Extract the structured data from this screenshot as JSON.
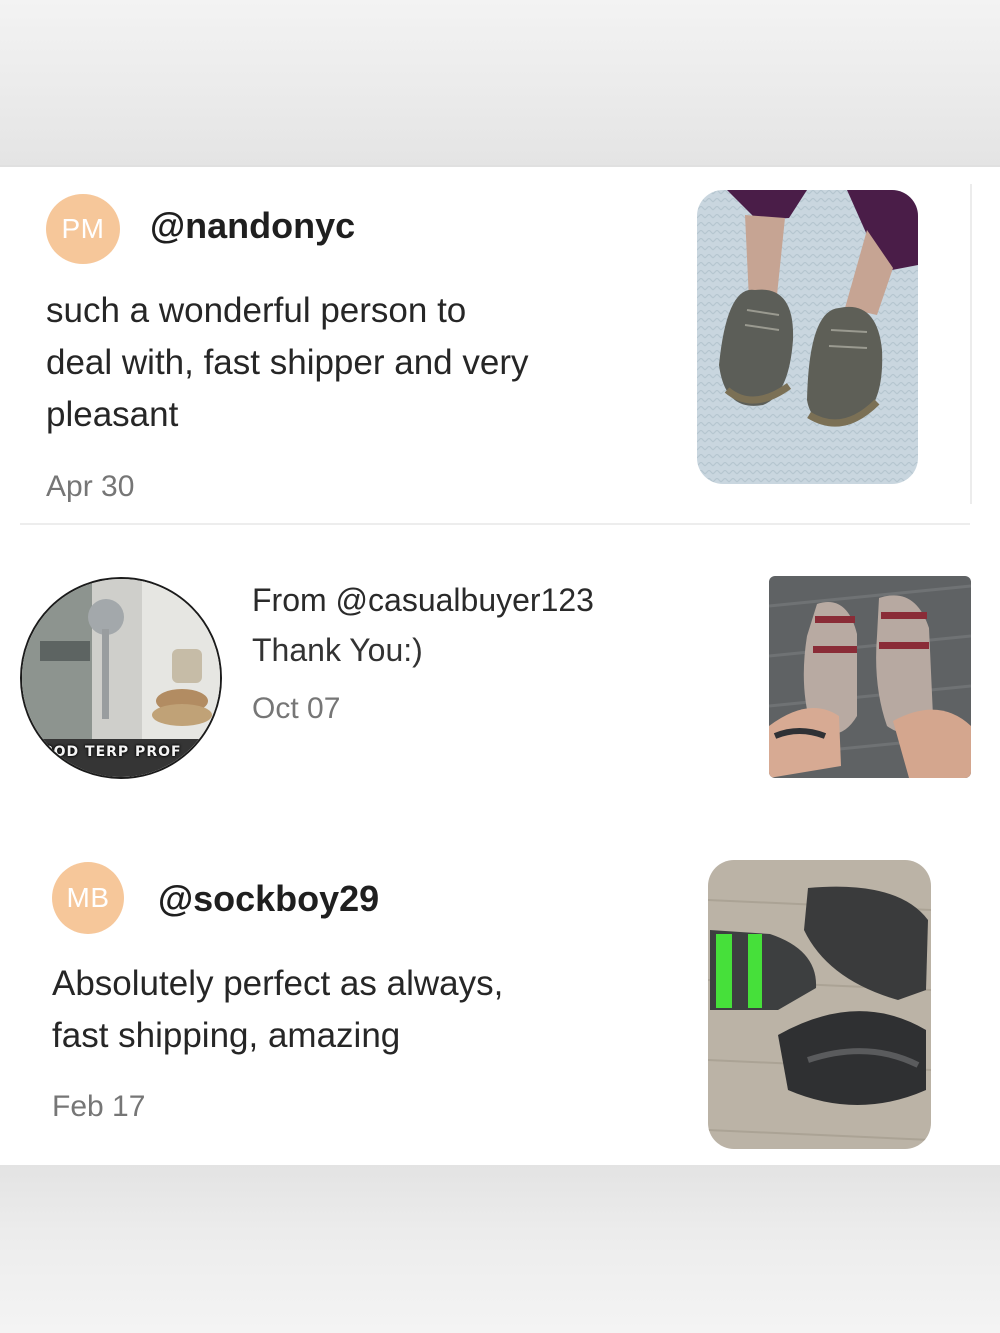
{
  "reviews": [
    {
      "avatar_initials": "PM",
      "handle": "@nandonyc",
      "text_lines": [
        "such a wonderful person to",
        "deal with, fast shipper and very",
        "pleasant"
      ],
      "date": "Apr 30",
      "photo": "shoes-on-rug-photo"
    },
    {
      "avatar": "user-photo-avatar",
      "avatar_caption": "UPOD TERP PROF",
      "from": "From @casualbuyer123",
      "message": "Thank You:)",
      "date": "Oct 07",
      "photo": "slippers-photo"
    },
    {
      "avatar_initials": "MB",
      "handle": "@sockboy29",
      "text_lines": [
        "Absolutely perfect as always,",
        "fast shipping, amazing"
      ],
      "date": "Feb 17",
      "photo": "socks-photo"
    }
  ],
  "colors": {
    "initials_bg": "#f6c79a",
    "text_primary": "#1f1f1f",
    "text_muted": "#767676"
  }
}
